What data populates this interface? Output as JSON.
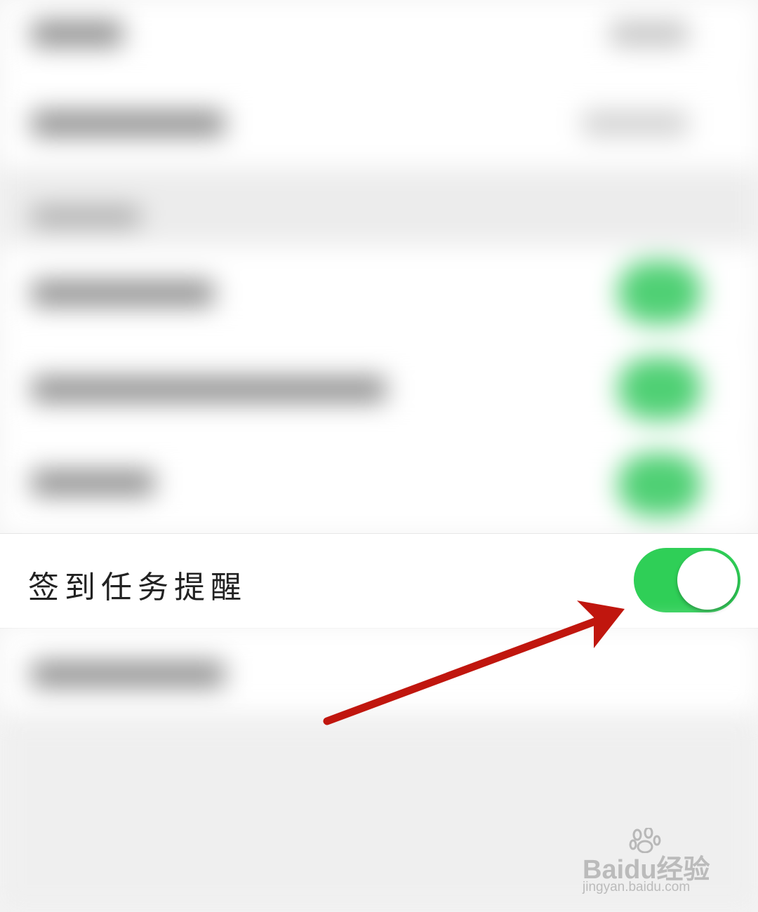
{
  "settings": {
    "reminder_row": {
      "label": "签到任务提醒",
      "toggle_on": true
    }
  },
  "colors": {
    "toggle_on": "#2fcf57",
    "arrow": "#c0160e"
  },
  "watermark": {
    "brand": "Baidu经验",
    "url": "jingyan.baidu.com"
  }
}
